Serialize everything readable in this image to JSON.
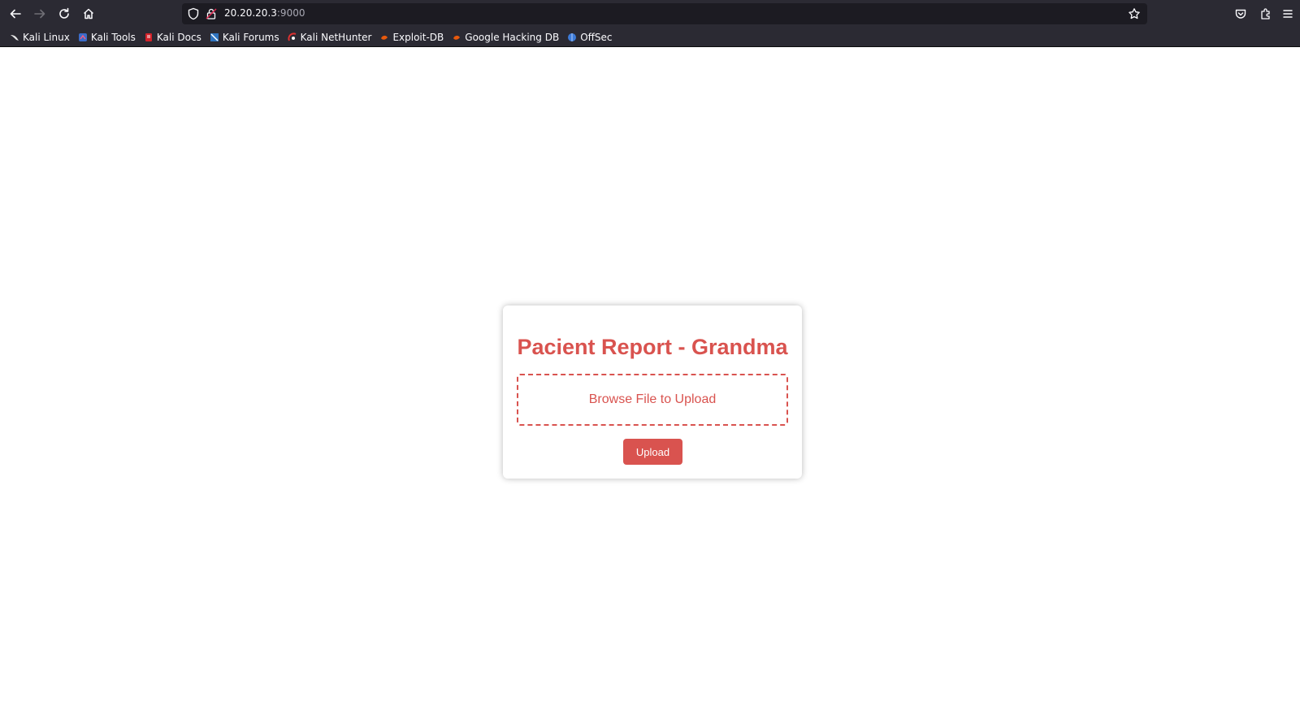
{
  "browser": {
    "url_host": "20.20.20.3",
    "url_port": ":9000",
    "bookmarks": [
      {
        "label": "Kali Linux",
        "icon": "kali-dragon-icon",
        "color": "#ffffff"
      },
      {
        "label": "Kali Tools",
        "icon": "kali-tools-icon",
        "color": "#3b6cc9"
      },
      {
        "label": "Kali Docs",
        "icon": "kali-docs-icon",
        "color": "#d3222a"
      },
      {
        "label": "Kali Forums",
        "icon": "kali-forums-icon",
        "color": "#2f74c0"
      },
      {
        "label": "Kali NetHunter",
        "icon": "kali-nethunter-icon",
        "color": "#e03131"
      },
      {
        "label": "Exploit-DB",
        "icon": "exploit-db-icon",
        "color": "#e8590c"
      },
      {
        "label": "Google Hacking DB",
        "icon": "ghdb-icon",
        "color": "#e8590c"
      },
      {
        "label": "OffSec",
        "icon": "offsec-icon",
        "color": "#3d7bd8"
      }
    ]
  },
  "page": {
    "title": "Pacient Report - Grandma",
    "dropzone_label": "Browse File to Upload",
    "upload_label": "Upload",
    "accent_color": "#d9534f"
  }
}
